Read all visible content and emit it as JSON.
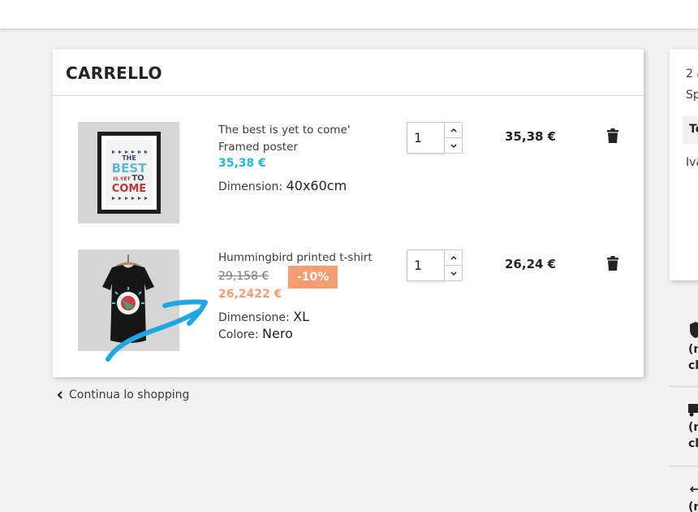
{
  "cart": {
    "title": "CARRELLO",
    "continue_label": "Continua lo shopping",
    "items": [
      {
        "name_line1": "The best is yet to come'",
        "name_line2": "Framed poster",
        "price": "35,38 €",
        "attributes": [
          {
            "label": "Dimension:",
            "value": "40x60cm"
          }
        ],
        "quantity": "1",
        "total": "35,38 €",
        "image_icon": "framed-poster",
        "poster_text": [
          "THE",
          "BEST",
          "IS YET",
          "TO",
          "COME"
        ]
      },
      {
        "name_line1": "Hummingbird printed t-shirt",
        "old_price": "29,158 €",
        "discount": "-10%",
        "price": "26,2422 €",
        "attributes": [
          {
            "label": "Dimensione:",
            "value": "XL"
          },
          {
            "label": "Colore:",
            "value": "Nero"
          }
        ],
        "quantity": "1",
        "total": "26,24 €",
        "image_icon": "tshirt"
      }
    ]
  },
  "summary": {
    "line1": "2 a",
    "line2": "Sp",
    "total_label": "To",
    "tax_label": "Iva"
  },
  "reassurance": [
    {
      "icon": "shield-icon",
      "line1": "(n",
      "line2": "cl"
    },
    {
      "icon": "truck-icon",
      "line1": "(n",
      "line2": "cl"
    },
    {
      "icon": "arrows-icon",
      "line1": "(n",
      "line2": ""
    }
  ],
  "colors": {
    "accent": "#24b9d7",
    "discount": "#f39d72",
    "annotation": "#1fa7e4"
  }
}
